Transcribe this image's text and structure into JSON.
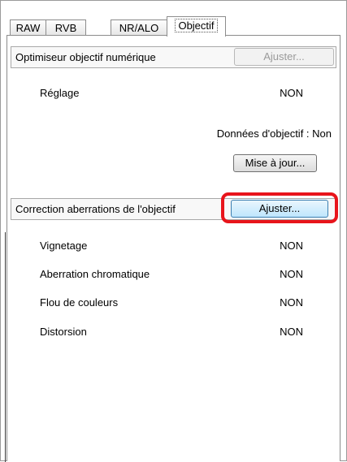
{
  "tabs": [
    {
      "label": "RAW"
    },
    {
      "label": "RVB"
    },
    {
      "label": "NR/ALO"
    },
    {
      "label": "Objectif",
      "active": true
    }
  ],
  "dlo": {
    "title": "Optimiseur objectif numérique",
    "adjust_label": "Ajuster...",
    "setting_label": "Réglage",
    "setting_value": "NON",
    "lens_data_text": "Données d'objectif : Non",
    "update_label": "Mise à jour..."
  },
  "correction": {
    "title": "Correction aberrations de l'objectif",
    "adjust_label": "Ajuster...",
    "items": [
      {
        "label": "Vignetage",
        "value": "NON"
      },
      {
        "label": "Aberration chromatique",
        "value": "NON"
      },
      {
        "label": "Flou de couleurs",
        "value": "NON"
      },
      {
        "label": "Distorsion",
        "value": "NON"
      }
    ]
  },
  "colors": {
    "highlight_ring": "#e8141b",
    "button_hover": "#bee6fd"
  }
}
